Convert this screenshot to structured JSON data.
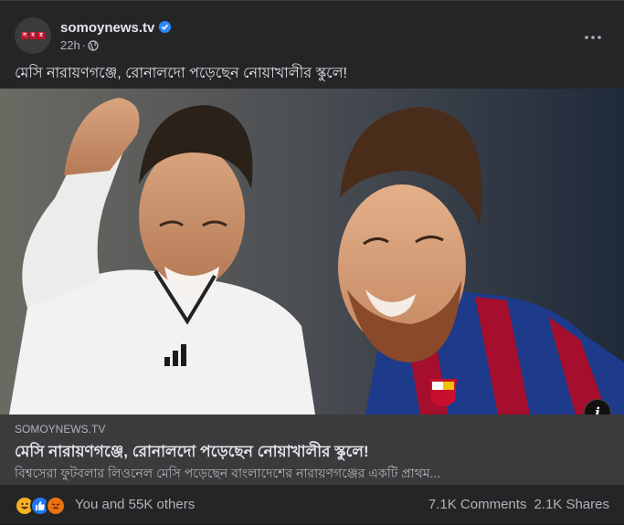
{
  "post": {
    "page_name": "somoynews.tv",
    "verified_icon": "verified-badge-icon",
    "time": "22h",
    "separator": "·",
    "audience_icon": "globe-icon",
    "more_icon": "more-options-icon",
    "caption": "মেসি নারায়ণগঞ্জে, রোনালদো পড়েছেন নোয়াখালীর স্কুলে!",
    "avatar_logo": [
      "স",
      "ম",
      "য়"
    ]
  },
  "link_preview": {
    "domain": "SOMOYNEWS.TV",
    "title": "মেসি নারায়ণগঞ্জে, রোনালদো পড়েছেন নোয়াখালীর স্কুলে!",
    "description": "বিশ্বসেরা ফুটবলার লিওনেল মেসি পড়েছেন বাংলাদেশের নারায়ণগঞ্জের একটি প্রাথম...",
    "info_label": "i"
  },
  "footer": {
    "reactions": [
      "haha",
      "like",
      "angry"
    ],
    "reaction_text": "You and 55K others",
    "comments": "7.1K Comments",
    "shares": "2.1K Shares"
  },
  "colors": {
    "background": "#242526",
    "link_box": "#3a3b3c",
    "text_primary": "#e4e6eb",
    "text_secondary": "#b0b3b8",
    "verified": "#2d88ff",
    "brand_red": "#c8102e"
  }
}
